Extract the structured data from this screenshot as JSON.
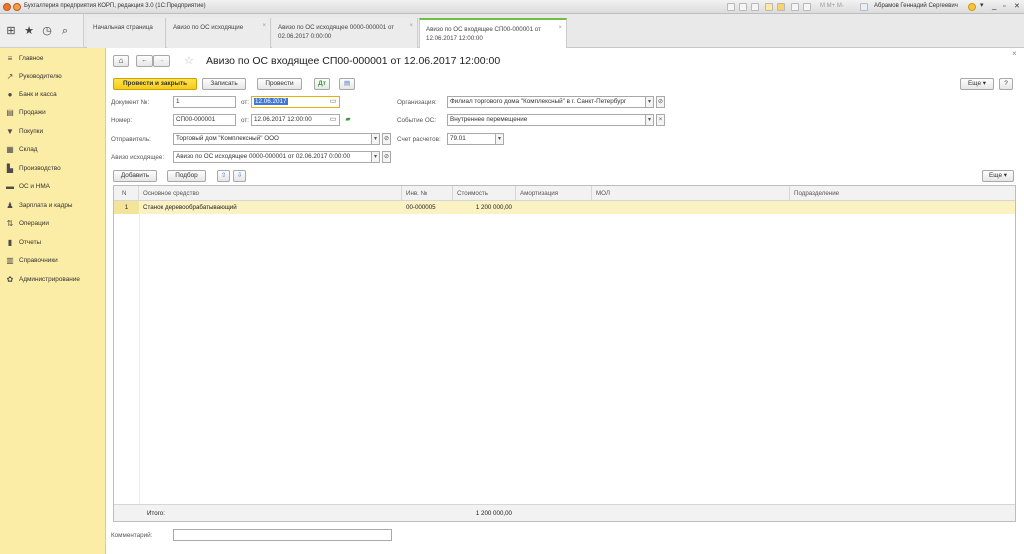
{
  "window": {
    "title": "Бухгалтерия предприятия КОРП, редакция 3.0  (1С:Предприятие)",
    "user": "Абрамов Геннадий Сергеевич"
  },
  "tabs": [
    {
      "label": "Начальная страница"
    },
    {
      "label": "Авизо по ОС исходящие"
    },
    {
      "label": "Авизо по ОС исходящее 0000-000001 от 02.06.2017 0:00:00"
    },
    {
      "label": "Авизо по ОС входящее СП00-000001 от 12.06.2017 12:00:00"
    }
  ],
  "sidebar": {
    "items": [
      {
        "label": "Главное",
        "icon": "menu-lines-icon"
      },
      {
        "label": "Руководителю",
        "icon": "trend-icon"
      },
      {
        "label": "Банк и касса",
        "icon": "bank-icon"
      },
      {
        "label": "Продажи",
        "icon": "sales-icon"
      },
      {
        "label": "Покупки",
        "icon": "cart-icon"
      },
      {
        "label": "Склад",
        "icon": "warehouse-icon"
      },
      {
        "label": "Производство",
        "icon": "factory-icon"
      },
      {
        "label": "ОС и НМА",
        "icon": "truck-icon"
      },
      {
        "label": "Зарплата и кадры",
        "icon": "person-icon"
      },
      {
        "label": "Операции",
        "icon": "operations-icon"
      },
      {
        "label": "Отчеты",
        "icon": "report-icon"
      },
      {
        "label": "Справочники",
        "icon": "book-icon"
      },
      {
        "label": "Администрирование",
        "icon": "gear-icon"
      }
    ]
  },
  "doc": {
    "title": "Авизо по ОС входящее СП00-000001 от 12.06.2017 12:00:00",
    "buttons": {
      "post_close": "Провести и закрыть",
      "save": "Записать",
      "post": "Провести",
      "more": "Еще",
      "help": "?"
    },
    "fields": {
      "doc_no_label": "Документ №:",
      "doc_no": "1",
      "from_label": "от:",
      "doc_date": "12.06.2017",
      "number_label": "Номер:",
      "number": "СП00-000001",
      "number_date": "12.06.2017 12:00:00",
      "sender_label": "Отправитель:",
      "sender": "Торговый дом \"Комплексный\" ООО",
      "outgoing_label": "Авизо исходящее:",
      "outgoing": "Авизо по ОС исходящее 0000-000001 от 02.06.2017 0:00:00",
      "org_label": "Организация:",
      "org": "Филиал торгового дома \"Комплексный\" в г. Санкт-Петербург",
      "event_label": "Событие ОС:",
      "event": "Внутреннее перемещение",
      "account_label": "Счет расчетов:",
      "account": "79.01"
    },
    "table_toolbar": {
      "add": "Добавить",
      "pick": "Подбор",
      "more": "Еще"
    },
    "table": {
      "columns": [
        "N",
        "Основное средство",
        "Инв. №",
        "Стоимость",
        "Амортизация",
        "МОЛ",
        "Подразделение"
      ],
      "rows": [
        {
          "n": "1",
          "asset": "Станок деревообрабатывающий",
          "inv": "00-000005",
          "cost": "1 200 000,00",
          "amort": "",
          "mol": "",
          "dept": ""
        }
      ],
      "totals_label": "Итого:",
      "totals_cost": "1 200 000,00"
    },
    "comment_label": "Комментарий:",
    "comment": ""
  }
}
